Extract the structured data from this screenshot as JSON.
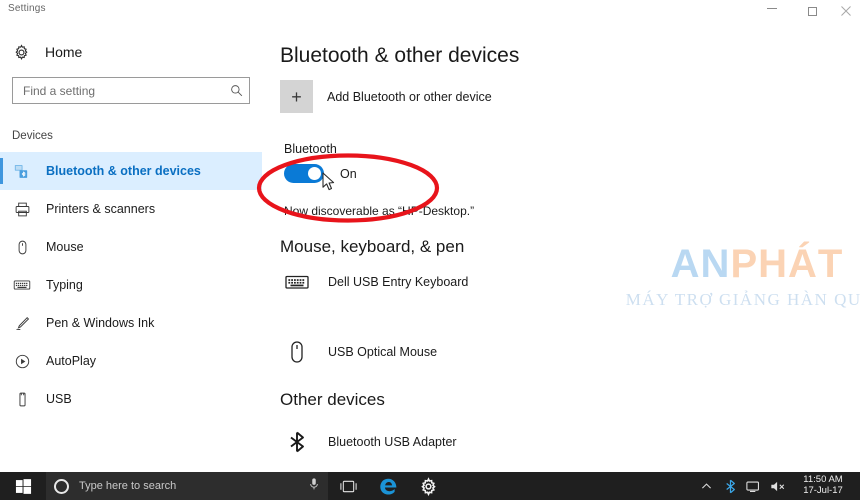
{
  "window": {
    "title": "Settings",
    "minimize_label": "Minimize",
    "maximize_label": "Maximize",
    "close_label": "Close"
  },
  "sidebar": {
    "home_label": "Home",
    "search": {
      "placeholder": "Find a setting",
      "value": "",
      "icon": "search-icon"
    },
    "section_label": "Devices",
    "items": [
      {
        "label": "Bluetooth & other devices",
        "icon": "bluetooth-devices-icon",
        "selected": true
      },
      {
        "label": "Printers & scanners",
        "icon": "printer-icon",
        "selected": false
      },
      {
        "label": "Mouse",
        "icon": "mouse-icon",
        "selected": false
      },
      {
        "label": "Typing",
        "icon": "keyboard-icon",
        "selected": false
      },
      {
        "label": "Pen & Windows Ink",
        "icon": "pen-icon",
        "selected": false
      },
      {
        "label": "AutoPlay",
        "icon": "autoplay-icon",
        "selected": false
      },
      {
        "label": "USB",
        "icon": "usb-icon",
        "selected": false
      }
    ]
  },
  "main": {
    "page_title": "Bluetooth & other devices",
    "add_device": {
      "label": "Add Bluetooth or other device",
      "icon": "plus-icon"
    },
    "bluetooth": {
      "label": "Bluetooth",
      "state_label": "On",
      "is_on": true,
      "discoverable_text": "Now discoverable as “HP-Desktop.”"
    },
    "sections": [
      {
        "heading": "Mouse, keyboard, & pen",
        "devices": [
          {
            "name": "Dell USB Entry Keyboard",
            "icon": "keyboard-icon"
          },
          {
            "name": "USB Optical Mouse",
            "icon": "mouse-icon"
          }
        ]
      },
      {
        "heading": "Other devices",
        "devices": [
          {
            "name": "Bluetooth USB Adapter",
            "icon": "bluetooth-icon"
          }
        ]
      }
    ]
  },
  "annotation": {
    "shape": "ellipse",
    "color": "#E8141B",
    "target": "bluetooth-toggle"
  },
  "watermark": {
    "text_primary": "AN",
    "text_secondary": "PHÁT",
    "subtitle": "MÁY TRỢ GIẢNG HÀN QUỐC",
    "color_primary": "#B9D8F2",
    "color_secondary": "#FBD3B4"
  },
  "taskbar": {
    "start_label": "Start",
    "search_placeholder": "Type here to search",
    "cortana_icon": "cortana-circle-icon",
    "mic_icon": "microphone-icon",
    "taskview_label": "Task View",
    "edge_label": "Microsoft Edge",
    "settings_label": "Settings",
    "tray": {
      "show_hidden_label": "Show hidden icons",
      "bluetooth_label": "Bluetooth",
      "network_label": "Network",
      "volume_label": "Volume muted",
      "time": "11:50 AM",
      "date": "17-Jul-17"
    }
  },
  "colors": {
    "accent": "#0A7AD6",
    "selected_bg": "#DBEEFF",
    "selected_text": "#0A6FC2",
    "annotation_red": "#E8141B",
    "taskbar_bg": "#1F1F1F"
  }
}
